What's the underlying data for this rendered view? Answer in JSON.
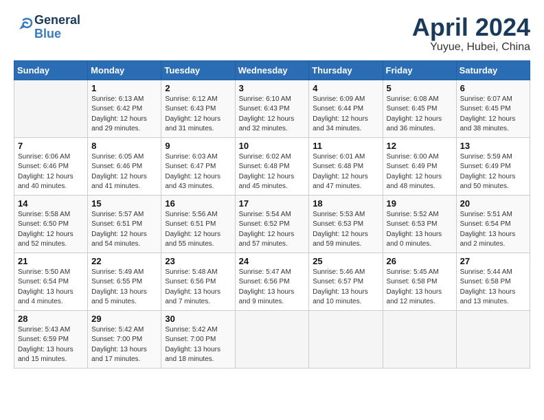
{
  "header": {
    "logo_line1": "General",
    "logo_line2": "Blue",
    "month_year": "April 2024",
    "location": "Yuyue, Hubei, China"
  },
  "weekdays": [
    "Sunday",
    "Monday",
    "Tuesday",
    "Wednesday",
    "Thursday",
    "Friday",
    "Saturday"
  ],
  "weeks": [
    [
      {
        "day": "",
        "content": ""
      },
      {
        "day": "1",
        "content": "Sunrise: 6:13 AM\nSunset: 6:42 PM\nDaylight: 12 hours\nand 29 minutes."
      },
      {
        "day": "2",
        "content": "Sunrise: 6:12 AM\nSunset: 6:43 PM\nDaylight: 12 hours\nand 31 minutes."
      },
      {
        "day": "3",
        "content": "Sunrise: 6:10 AM\nSunset: 6:43 PM\nDaylight: 12 hours\nand 32 minutes."
      },
      {
        "day": "4",
        "content": "Sunrise: 6:09 AM\nSunset: 6:44 PM\nDaylight: 12 hours\nand 34 minutes."
      },
      {
        "day": "5",
        "content": "Sunrise: 6:08 AM\nSunset: 6:45 PM\nDaylight: 12 hours\nand 36 minutes."
      },
      {
        "day": "6",
        "content": "Sunrise: 6:07 AM\nSunset: 6:45 PM\nDaylight: 12 hours\nand 38 minutes."
      }
    ],
    [
      {
        "day": "7",
        "content": "Sunrise: 6:06 AM\nSunset: 6:46 PM\nDaylight: 12 hours\nand 40 minutes."
      },
      {
        "day": "8",
        "content": "Sunrise: 6:05 AM\nSunset: 6:46 PM\nDaylight: 12 hours\nand 41 minutes."
      },
      {
        "day": "9",
        "content": "Sunrise: 6:03 AM\nSunset: 6:47 PM\nDaylight: 12 hours\nand 43 minutes."
      },
      {
        "day": "10",
        "content": "Sunrise: 6:02 AM\nSunset: 6:48 PM\nDaylight: 12 hours\nand 45 minutes."
      },
      {
        "day": "11",
        "content": "Sunrise: 6:01 AM\nSunset: 6:48 PM\nDaylight: 12 hours\nand 47 minutes."
      },
      {
        "day": "12",
        "content": "Sunrise: 6:00 AM\nSunset: 6:49 PM\nDaylight: 12 hours\nand 48 minutes."
      },
      {
        "day": "13",
        "content": "Sunrise: 5:59 AM\nSunset: 6:49 PM\nDaylight: 12 hours\nand 50 minutes."
      }
    ],
    [
      {
        "day": "14",
        "content": "Sunrise: 5:58 AM\nSunset: 6:50 PM\nDaylight: 12 hours\nand 52 minutes."
      },
      {
        "day": "15",
        "content": "Sunrise: 5:57 AM\nSunset: 6:51 PM\nDaylight: 12 hours\nand 54 minutes."
      },
      {
        "day": "16",
        "content": "Sunrise: 5:56 AM\nSunset: 6:51 PM\nDaylight: 12 hours\nand 55 minutes."
      },
      {
        "day": "17",
        "content": "Sunrise: 5:54 AM\nSunset: 6:52 PM\nDaylight: 12 hours\nand 57 minutes."
      },
      {
        "day": "18",
        "content": "Sunrise: 5:53 AM\nSunset: 6:53 PM\nDaylight: 12 hours\nand 59 minutes."
      },
      {
        "day": "19",
        "content": "Sunrise: 5:52 AM\nSunset: 6:53 PM\nDaylight: 13 hours\nand 0 minutes."
      },
      {
        "day": "20",
        "content": "Sunrise: 5:51 AM\nSunset: 6:54 PM\nDaylight: 13 hours\nand 2 minutes."
      }
    ],
    [
      {
        "day": "21",
        "content": "Sunrise: 5:50 AM\nSunset: 6:54 PM\nDaylight: 13 hours\nand 4 minutes."
      },
      {
        "day": "22",
        "content": "Sunrise: 5:49 AM\nSunset: 6:55 PM\nDaylight: 13 hours\nand 5 minutes."
      },
      {
        "day": "23",
        "content": "Sunrise: 5:48 AM\nSunset: 6:56 PM\nDaylight: 13 hours\nand 7 minutes."
      },
      {
        "day": "24",
        "content": "Sunrise: 5:47 AM\nSunset: 6:56 PM\nDaylight: 13 hours\nand 9 minutes."
      },
      {
        "day": "25",
        "content": "Sunrise: 5:46 AM\nSunset: 6:57 PM\nDaylight: 13 hours\nand 10 minutes."
      },
      {
        "day": "26",
        "content": "Sunrise: 5:45 AM\nSunset: 6:58 PM\nDaylight: 13 hours\nand 12 minutes."
      },
      {
        "day": "27",
        "content": "Sunrise: 5:44 AM\nSunset: 6:58 PM\nDaylight: 13 hours\nand 13 minutes."
      }
    ],
    [
      {
        "day": "28",
        "content": "Sunrise: 5:43 AM\nSunset: 6:59 PM\nDaylight: 13 hours\nand 15 minutes."
      },
      {
        "day": "29",
        "content": "Sunrise: 5:42 AM\nSunset: 7:00 PM\nDaylight: 13 hours\nand 17 minutes."
      },
      {
        "day": "30",
        "content": "Sunrise: 5:42 AM\nSunset: 7:00 PM\nDaylight: 13 hours\nand 18 minutes."
      },
      {
        "day": "",
        "content": ""
      },
      {
        "day": "",
        "content": ""
      },
      {
        "day": "",
        "content": ""
      },
      {
        "day": "",
        "content": ""
      }
    ]
  ]
}
